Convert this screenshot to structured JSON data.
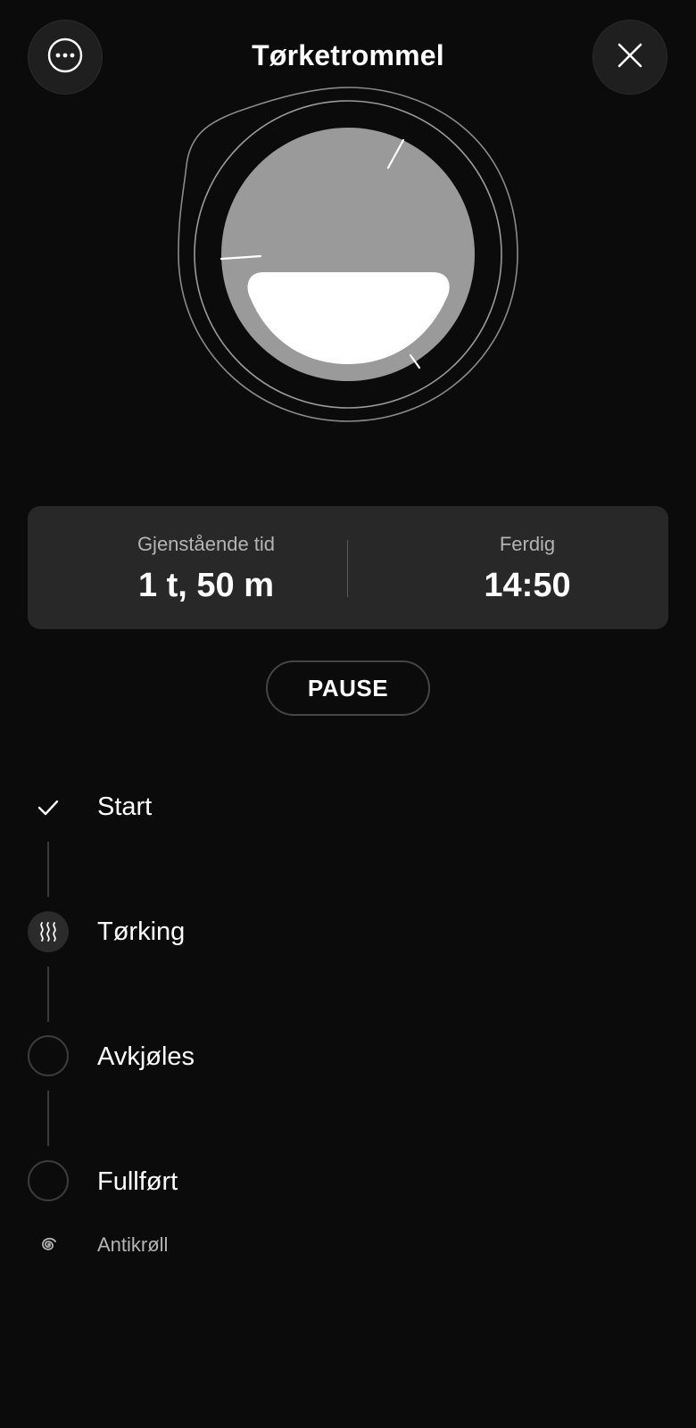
{
  "header": {
    "title": "Tørketrommel",
    "more_icon": "more-horizontal-icon",
    "close_icon": "close-icon"
  },
  "drum": {
    "icon": "dryer-drum-illustration"
  },
  "info": {
    "remaining_label": "Gjenstående tid",
    "remaining_value": "1 t, 50 m",
    "finish_label": "Ferdig",
    "finish_value": "14:50"
  },
  "controls": {
    "pause_label": "PAUSE"
  },
  "steps": [
    {
      "label": "Start",
      "state": "done",
      "icon": "check-icon"
    },
    {
      "label": "Tørking",
      "state": "active",
      "icon": "heat-waves-icon"
    },
    {
      "label": "Avkjøles",
      "state": "pending",
      "icon": "empty-circle-icon"
    },
    {
      "label": "Fullført",
      "state": "pending",
      "icon": "empty-circle-icon"
    }
  ],
  "option": {
    "label": "Antikrøll",
    "icon": "spiral-icon"
  },
  "colors": {
    "background": "#0b0b0b",
    "card": "#282828",
    "text_primary": "#ffffff",
    "text_secondary": "#b4b4b4"
  }
}
